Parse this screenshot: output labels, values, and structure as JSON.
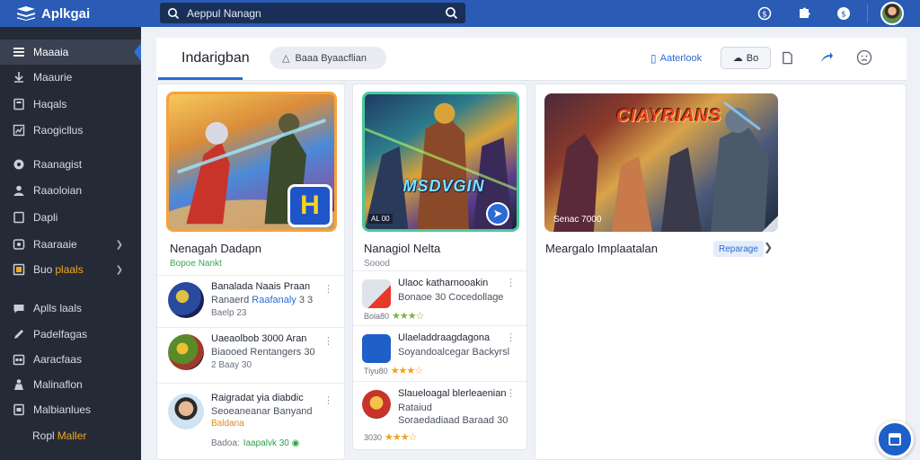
{
  "app": {
    "brand": "Aplkgai"
  },
  "search": {
    "value": "Aeppul Nanagn"
  },
  "sidebar": {
    "items": [
      {
        "label": "Maaaia",
        "icon": "menu-icon",
        "active": true
      },
      {
        "label": "Maaurie",
        "icon": "download-icon"
      },
      {
        "label": "Haqals",
        "icon": "book-icon"
      },
      {
        "label": "Raogicllus",
        "icon": "chart-icon"
      },
      {
        "label": "Raanagist",
        "icon": "tag-icon"
      },
      {
        "label": "Raaoloian",
        "icon": "user-icon"
      },
      {
        "label": "Dapli",
        "icon": "document-icon"
      },
      {
        "label": "Raaraaie",
        "icon": "shield-icon",
        "chevron": true
      },
      {
        "label": "Buo",
        "highlight": "plaals",
        "icon": "box-icon",
        "chevron": true
      },
      {
        "label": "Aplls laals",
        "icon": "chat-icon"
      },
      {
        "label": "Padelfagas",
        "icon": "pen-icon"
      },
      {
        "label": "Aaracfaas",
        "icon": "calendar-icon"
      },
      {
        "label": "Malinaflon",
        "icon": "person-icon"
      },
      {
        "label": "Malbianlues",
        "icon": "lock-icon"
      },
      {
        "label": "Ropl",
        "highlight": "Maller",
        "icon": "none"
      }
    ]
  },
  "header": {
    "tab": "Indarigban",
    "pill": "Baaa Byaacflian",
    "link": "Aaterlook",
    "button": "Bo"
  },
  "col1": {
    "title": "Nenagah Dadapn",
    "subtitle": "Bopoe Nankt",
    "badge": "H",
    "rows": [
      {
        "line1": "Banalada Naais  Praan",
        "line2a": "Ranaerd ",
        "line2b": "Raafanaly",
        "line2c": " 3  3",
        "line3": "Baelp  23"
      },
      {
        "line1": "Uaeaolbob 3000 Aran",
        "line2": "Biaooed Rentangers 30",
        "line3": "2 Baay 30"
      },
      {
        "line1": "Raigradat yia diabdic",
        "line2": "Seoeaneanar Banyand",
        "line3": "Baldana",
        "foot_pre": "Badoa:",
        "foot_green": "Iaapalvk 30"
      }
    ]
  },
  "col2": {
    "title": "Nanagiol Nelta",
    "subtitle": "Soood",
    "hero_title": "MSDVGIN",
    "hero_tag": "AL 00",
    "items": [
      {
        "line1": "Ulaoc katharnooakin",
        "line2": "Bonaoe 30 Cocedollage",
        "rating_pre": "Bola80"
      },
      {
        "line1": "Ulaeladdraagdagona",
        "line2": "Soyandoalcegar Backyrsl",
        "rating_pre": "Tiyu80"
      },
      {
        "line1": "Slaueloagal blerleaenian",
        "line2": "Rataiud",
        "line3": "Soraedadiaad Baraad 30",
        "rating_pre": "3030"
      }
    ]
  },
  "col3": {
    "hero_title": "CIAYRIANS",
    "caption": "Senac 7000",
    "title": "Meargalo Implaatalan",
    "tag": "Reparage"
  }
}
